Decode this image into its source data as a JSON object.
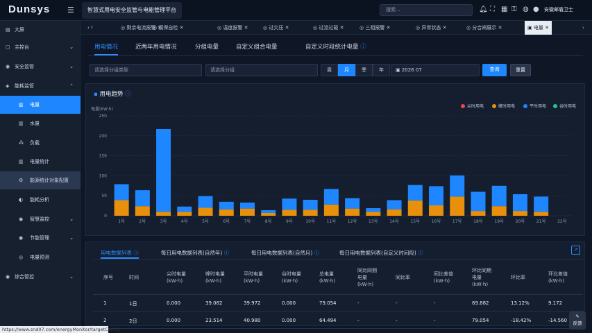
{
  "app": {
    "logo": "Dunsys",
    "system_title": "智慧式用电安全监管与电能管理平台",
    "search_placeholder": "搜索...",
    "user_name": "安徽邮盾卫士"
  },
  "sidebar": [
    {
      "label": "大屏",
      "icon": "▤",
      "chev": ""
    },
    {
      "label": "主控台",
      "icon": "▢",
      "chev": "⌄"
    },
    {
      "label": "安全监管",
      "icon": "◉",
      "chev": "⌄"
    },
    {
      "label": "能耗监管",
      "icon": "◈",
      "chev": "⌃"
    },
    {
      "label": "电量",
      "icon": "▥",
      "chev": "",
      "sub": true,
      "active": true
    },
    {
      "label": "水量",
      "icon": "▥",
      "chev": "",
      "sub": true
    },
    {
      "label": "负载",
      "icon": "⁂",
      "chev": "",
      "sub": true
    },
    {
      "label": "电量统计",
      "icon": "▥",
      "chev": "",
      "sub": true
    },
    {
      "label": "能源统计对象配置",
      "icon": "⚙",
      "chev": "",
      "sub": true,
      "selected": true
    },
    {
      "label": "能耗分析",
      "icon": "◐",
      "chev": "",
      "sub": true
    },
    {
      "label": "智慧监控",
      "icon": "◉",
      "chev": "⌄",
      "sub": true
    },
    {
      "label": "节能管理",
      "icon": "◉",
      "chev": "⌄",
      "sub": true
    },
    {
      "label": "电量预测",
      "icon": "◎",
      "chev": "",
      "sub": true
    },
    {
      "label": "综合管控",
      "icon": "◉",
      "chev": "⌄"
    }
  ],
  "tabs": [
    {
      "label": "剩余电流报警"
    },
    {
      "label": "漏保自检"
    },
    {
      "label": "温度报警"
    },
    {
      "label": "过欠压"
    },
    {
      "label": "过流过载"
    },
    {
      "label": "三相报警"
    },
    {
      "label": "异常状态"
    },
    {
      "label": "分合闸展示"
    },
    {
      "label": "电量",
      "active": true
    }
  ],
  "subtabs": [
    {
      "label": "用电情况",
      "active": true
    },
    {
      "label": "近两年用电情况"
    },
    {
      "label": "分组电量"
    },
    {
      "label": "自定义组合电量"
    },
    {
      "label": "自定义时段统计电量"
    }
  ],
  "filters": {
    "group_type": "请选择分组类型",
    "group": "请选择分组",
    "periods": [
      "周",
      "月",
      "季",
      "年"
    ],
    "active_period": "月",
    "date": "2026 07",
    "query_label": "查询",
    "reset_label": "重置"
  },
  "chart": {
    "title": "用电趋势",
    "unit_label": "电量(kW·h)",
    "legend": [
      {
        "name": "尖时用电",
        "color": "#e8454f"
      },
      {
        "name": "峰时用电",
        "color": "#e8900c"
      },
      {
        "name": "平时用电",
        "color": "#1e86ff"
      },
      {
        "name": "谷时用电",
        "color": "#24c48c"
      }
    ]
  },
  "chart_data": {
    "type": "bar",
    "stacked": true,
    "title": "用电趋势",
    "ylabel": "电量(kW·h)",
    "ylim": [
      0,
      250
    ],
    "yticks": [
      0,
      50,
      100,
      150,
      200,
      250
    ],
    "categories": [
      "1号",
      "2号",
      "3号",
      "4号",
      "5号",
      "6号",
      "7号",
      "8号",
      "9号",
      "10号",
      "11号",
      "12号",
      "13号",
      "14号",
      "15号",
      "16号",
      "17号",
      "18号",
      "19号",
      "20号",
      "21号",
      "22号"
    ],
    "series": [
      {
        "name": "尖时用电",
        "color": "#e8454f",
        "values": [
          0,
          0,
          0,
          0,
          0,
          0,
          0,
          0,
          0,
          0,
          0,
          0,
          0,
          0,
          0,
          0,
          0,
          0,
          0,
          0,
          0,
          0
        ]
      },
      {
        "name": "峰时用电",
        "color": "#e8900c",
        "values": [
          39,
          24,
          10,
          10,
          20,
          16,
          18,
          7,
          15,
          15,
          28,
          18,
          10,
          16,
          38,
          26,
          48,
          12,
          24,
          12,
          10,
          0
        ]
      },
      {
        "name": "平时用电",
        "color": "#1e86ff",
        "values": [
          40,
          40,
          207,
          13,
          29,
          19,
          15,
          7,
          28,
          25,
          39,
          26,
          9,
          23,
          39,
          48,
          53,
          48,
          51,
          42,
          38,
          0
        ]
      },
      {
        "name": "谷时用电",
        "color": "#24c48c",
        "values": [
          0,
          0,
          0,
          0,
          0,
          0,
          0,
          0,
          0,
          0,
          0,
          0,
          0,
          0,
          0,
          0,
          0,
          0,
          0,
          0,
          0,
          0
        ]
      }
    ],
    "grid": true,
    "legend_position": "top-right"
  },
  "table": {
    "tabs": [
      {
        "label": "用电数据列表",
        "active": true
      },
      {
        "label": "每日用电数据列表(自然年)"
      },
      {
        "label": "每日用电数据列表(自然月)"
      },
      {
        "label": "每日用电数据列表(自定义时间段)"
      }
    ],
    "headers": [
      "序号",
      "时间",
      "尖时电量\n(kW·h)",
      "峰时电量\n(kW·h)",
      "平时电量\n(kW·h)",
      "谷时电量\n(kW·h)",
      "总电量\n(kW·h)",
      "同比同期\n电量\n(kW·h)",
      "同比率",
      "同比差值\n(kW·h)",
      "环比同期\n电量\n(kW·h)",
      "环比率",
      "环比差值\n(kW·h)"
    ],
    "rows": [
      [
        "1",
        "1日",
        "0.000",
        "39.082",
        "39.972",
        "0.000",
        "79.054",
        "-",
        "-",
        "-",
        "69.882",
        "13.12%",
        "9.172"
      ],
      [
        "2",
        "2日",
        "0.000",
        "23.514",
        "40.980",
        "0.000",
        "64.494",
        "-",
        "-",
        "-",
        "79.054",
        "-18.42%",
        "-14.560"
      ]
    ]
  },
  "status_url": "https://www.snd07.com/energyMonitor/targetConfig",
  "feedback_label": "反馈"
}
